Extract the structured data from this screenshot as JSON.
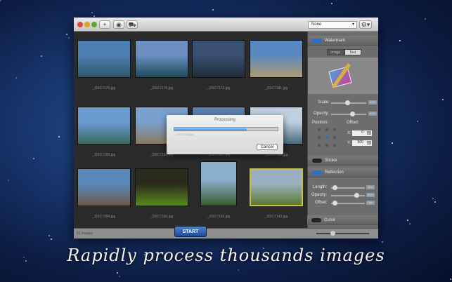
{
  "toolbar": {
    "preset_select": "None"
  },
  "gallery": {
    "images": [
      {
        "name": "_DSC7170.jpg",
        "c1": "#4e7fb0",
        "c2": "#2c5a6a"
      },
      {
        "name": "_DSC7176.jpg",
        "c1": "#6a8fc0",
        "c2": "#1e4a5a"
      },
      {
        "name": "_DSC7172.jpg",
        "c1": "#3a5070",
        "c2": "#202c3a"
      },
      {
        "name": "_DSC7181.jpg",
        "c1": "#5a88c0",
        "c2": "#b09a70"
      },
      {
        "name": "_DSC7193.jpg",
        "c1": "#6a9ad0",
        "c2": "#3a6a60"
      },
      {
        "name": "_DSC7192.jpg",
        "c1": "#7aa0d0",
        "c2": "#8a7a60"
      },
      {
        "name": "_DSC7197.jpg",
        "c1": "#5a80b0",
        "c2": "#304a5a"
      },
      {
        "name": "_DSC7199.jpg",
        "c1": "#c0d0e0",
        "c2": "#4a6a7a"
      },
      {
        "name": "_DSC7284.jpg",
        "c1": "#5a88b8",
        "c2": "#6a5a4a"
      },
      {
        "name": "_DSC7330.jpg",
        "c1": "#2a2a1a",
        "c2": "#5a8a20"
      },
      {
        "name": "_DSC7136.jpg",
        "c1": "#8ab0d0",
        "c2": "#3a5a2a"
      },
      {
        "name": "_DSC7143.jpg",
        "c1": "#9ab0c0",
        "c2": "#5a7a30"
      }
    ],
    "count": "12 images",
    "start": "START"
  },
  "dialog": {
    "title": "Processing",
    "progress": 0.7,
    "file": "_DSC7206.jpg",
    "cancel": "Cancel"
  },
  "sidebar": {
    "watermark": "Watermark",
    "tab_image": "Image",
    "tab_text": "Text",
    "scale": "Scale:",
    "scale_val": "50%",
    "opacity": "Opacity:",
    "opacity_val": "61%",
    "position": "Position:",
    "offset": "Offset:",
    "x_label": "X:",
    "x_val": "0",
    "y_label": "Y:",
    "y_val": "500",
    "unit": "px",
    "stroke": "Stroke",
    "reflection": "Reflection",
    "length": "Length:",
    "length_val": "10%",
    "r_opacity": "Opacity:",
    "r_opacity_val": "50%",
    "r_offset": "Offset:",
    "r_offset_val": "0px",
    "curve": "Curve"
  },
  "caption": "Rapidly process thousands images"
}
